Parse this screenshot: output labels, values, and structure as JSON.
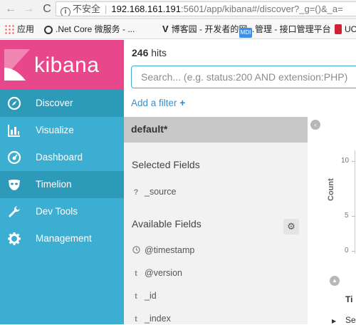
{
  "browser": {
    "nav_back": "←",
    "nav_forward": "→",
    "nav_reload": "C",
    "info_icon": "i",
    "security_label": "不安全",
    "url_host": "192.168.161.191",
    "url_path": ":5601/app/kibana#/discover?_g=()&_a=",
    "bookmarks": [
      {
        "label": "应用",
        "icon": "apps-grid-icon"
      },
      {
        "label": ".Net Core 微服务 - ...",
        "icon": "circle-icon"
      },
      {
        "label": "博客园 - 开发者的网...",
        "icon": "v-logo-icon",
        "icon_text": "V"
      },
      {
        "label": "管理 - 接口管理平台",
        "icon": "mdi-badge-icon",
        "icon_text": "MDI"
      },
      {
        "label": "UC",
        "icon": "uc-icon"
      }
    ]
  },
  "sidebar": {
    "logo_text": "kibana",
    "brand_color": "#e8488b",
    "bg_color": "#3caed2",
    "items": [
      {
        "label": "Discover",
        "icon": "compass-icon",
        "active": true
      },
      {
        "label": "Visualize",
        "icon": "bar-chart-icon",
        "active": false
      },
      {
        "label": "Dashboard",
        "icon": "gauge-icon",
        "active": false
      },
      {
        "label": "Timelion",
        "icon": "mask-icon",
        "active": true
      },
      {
        "label": "Dev Tools",
        "icon": "wrench-icon",
        "active": false
      },
      {
        "label": "Management",
        "icon": "gear-icon",
        "active": false
      }
    ]
  },
  "discover": {
    "hits_count": "246",
    "hits_label": "hits",
    "search_placeholder": "Search... (e.g. status:200 AND extension:PHP)",
    "add_filter_label": "Add a filter",
    "add_filter_plus": "+",
    "index_pattern": "default*",
    "selected_fields_title": "Selected Fields",
    "selected_fields": [
      {
        "type": "?",
        "name": "_source"
      }
    ],
    "available_fields_title": "Available Fields",
    "available_fields": [
      {
        "type": "clock",
        "name": "@timestamp"
      },
      {
        "type": "t",
        "name": "@version"
      },
      {
        "type": "t",
        "name": "_id"
      },
      {
        "type": "t",
        "name": "_index"
      }
    ],
    "settings_icon": "⚙",
    "collapse_icon": "‹",
    "chart_ylabel": "Count",
    "y_ticks": [
      "10",
      "5",
      "0"
    ],
    "scroll_up_icon": "▲",
    "table_header": "Ti",
    "first_row_text": "Se",
    "row_caret": "▶"
  }
}
